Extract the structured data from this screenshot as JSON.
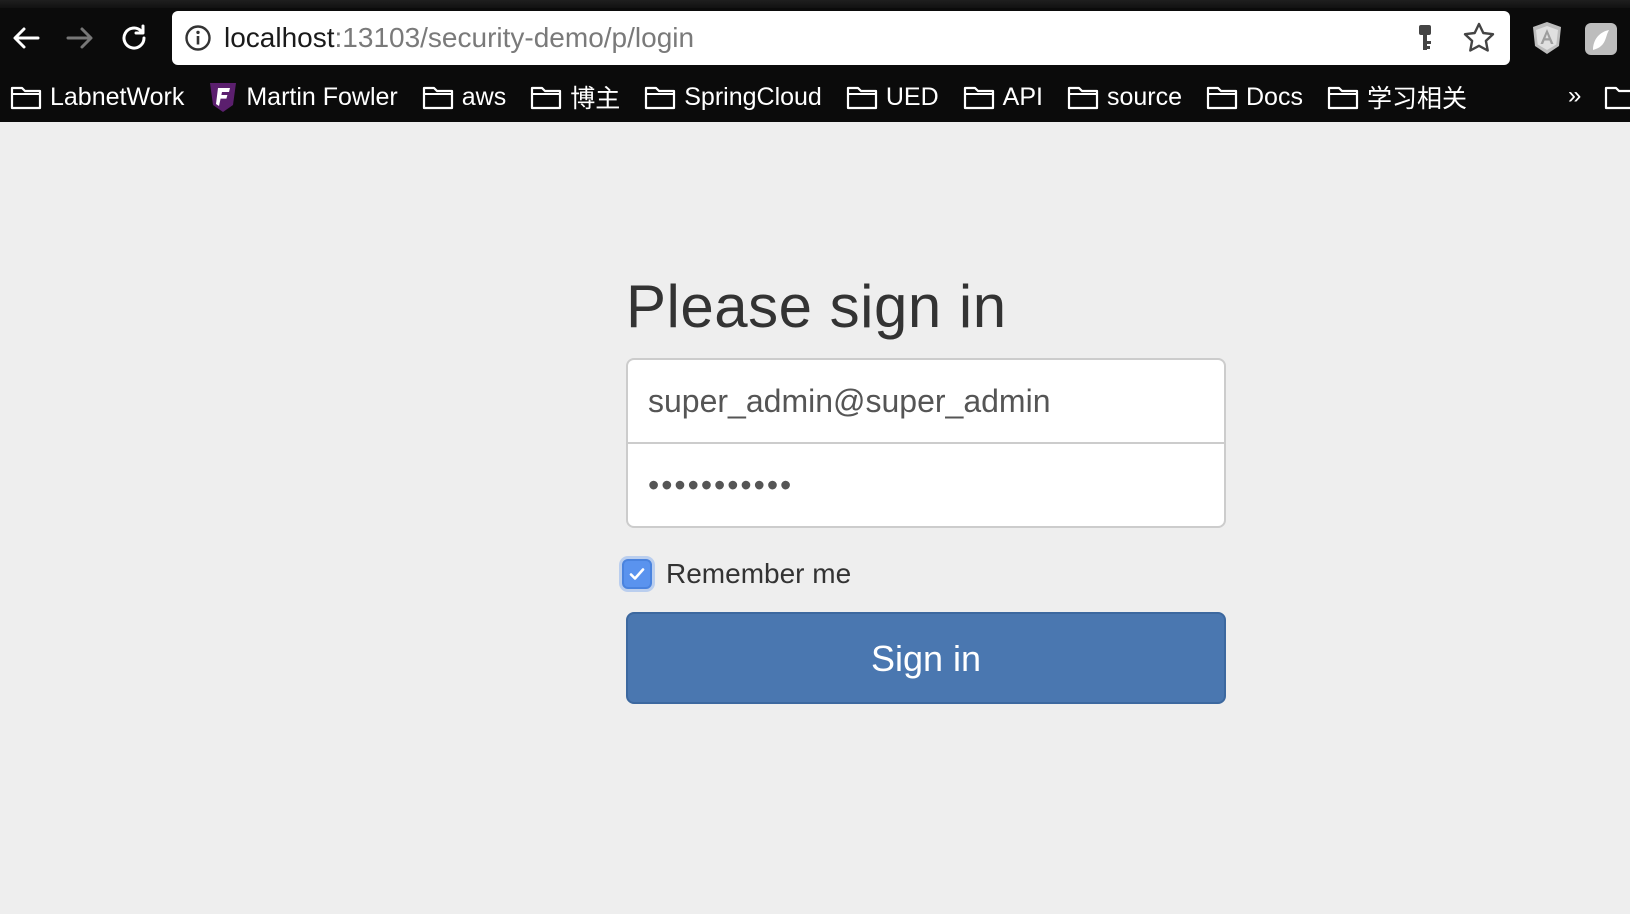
{
  "browser": {
    "url_host": "localhost",
    "url_rest": ":13103/security-demo/p/login"
  },
  "bookmarks": [
    {
      "label": "LabnetWork",
      "icon": "folder-icon"
    },
    {
      "label": "Martin Fowler",
      "icon": "martin-fowler-favicon"
    },
    {
      "label": "aws",
      "icon": "folder-icon"
    },
    {
      "label": "博主",
      "icon": "folder-icon"
    },
    {
      "label": "SpringCloud",
      "icon": "folder-icon"
    },
    {
      "label": "UED",
      "icon": "folder-icon"
    },
    {
      "label": "API",
      "icon": "folder-icon"
    },
    {
      "label": "source",
      "icon": "folder-icon"
    },
    {
      "label": "Docs",
      "icon": "folder-icon"
    },
    {
      "label": "学习相关",
      "icon": "folder-icon"
    }
  ],
  "bookmarks_more": "»",
  "login": {
    "heading": "Please sign in",
    "username_value": "super_admin@super_admin",
    "password_value": "•••••••••••",
    "remember_label": "Remember me",
    "remember_checked": true,
    "submit_label": "Sign in"
  },
  "colors": {
    "page_bg": "#eeeeee",
    "chrome_bg": "#0b0b0b",
    "button_primary": "#4a77b0",
    "checkbox_accent": "#5a93ee"
  }
}
